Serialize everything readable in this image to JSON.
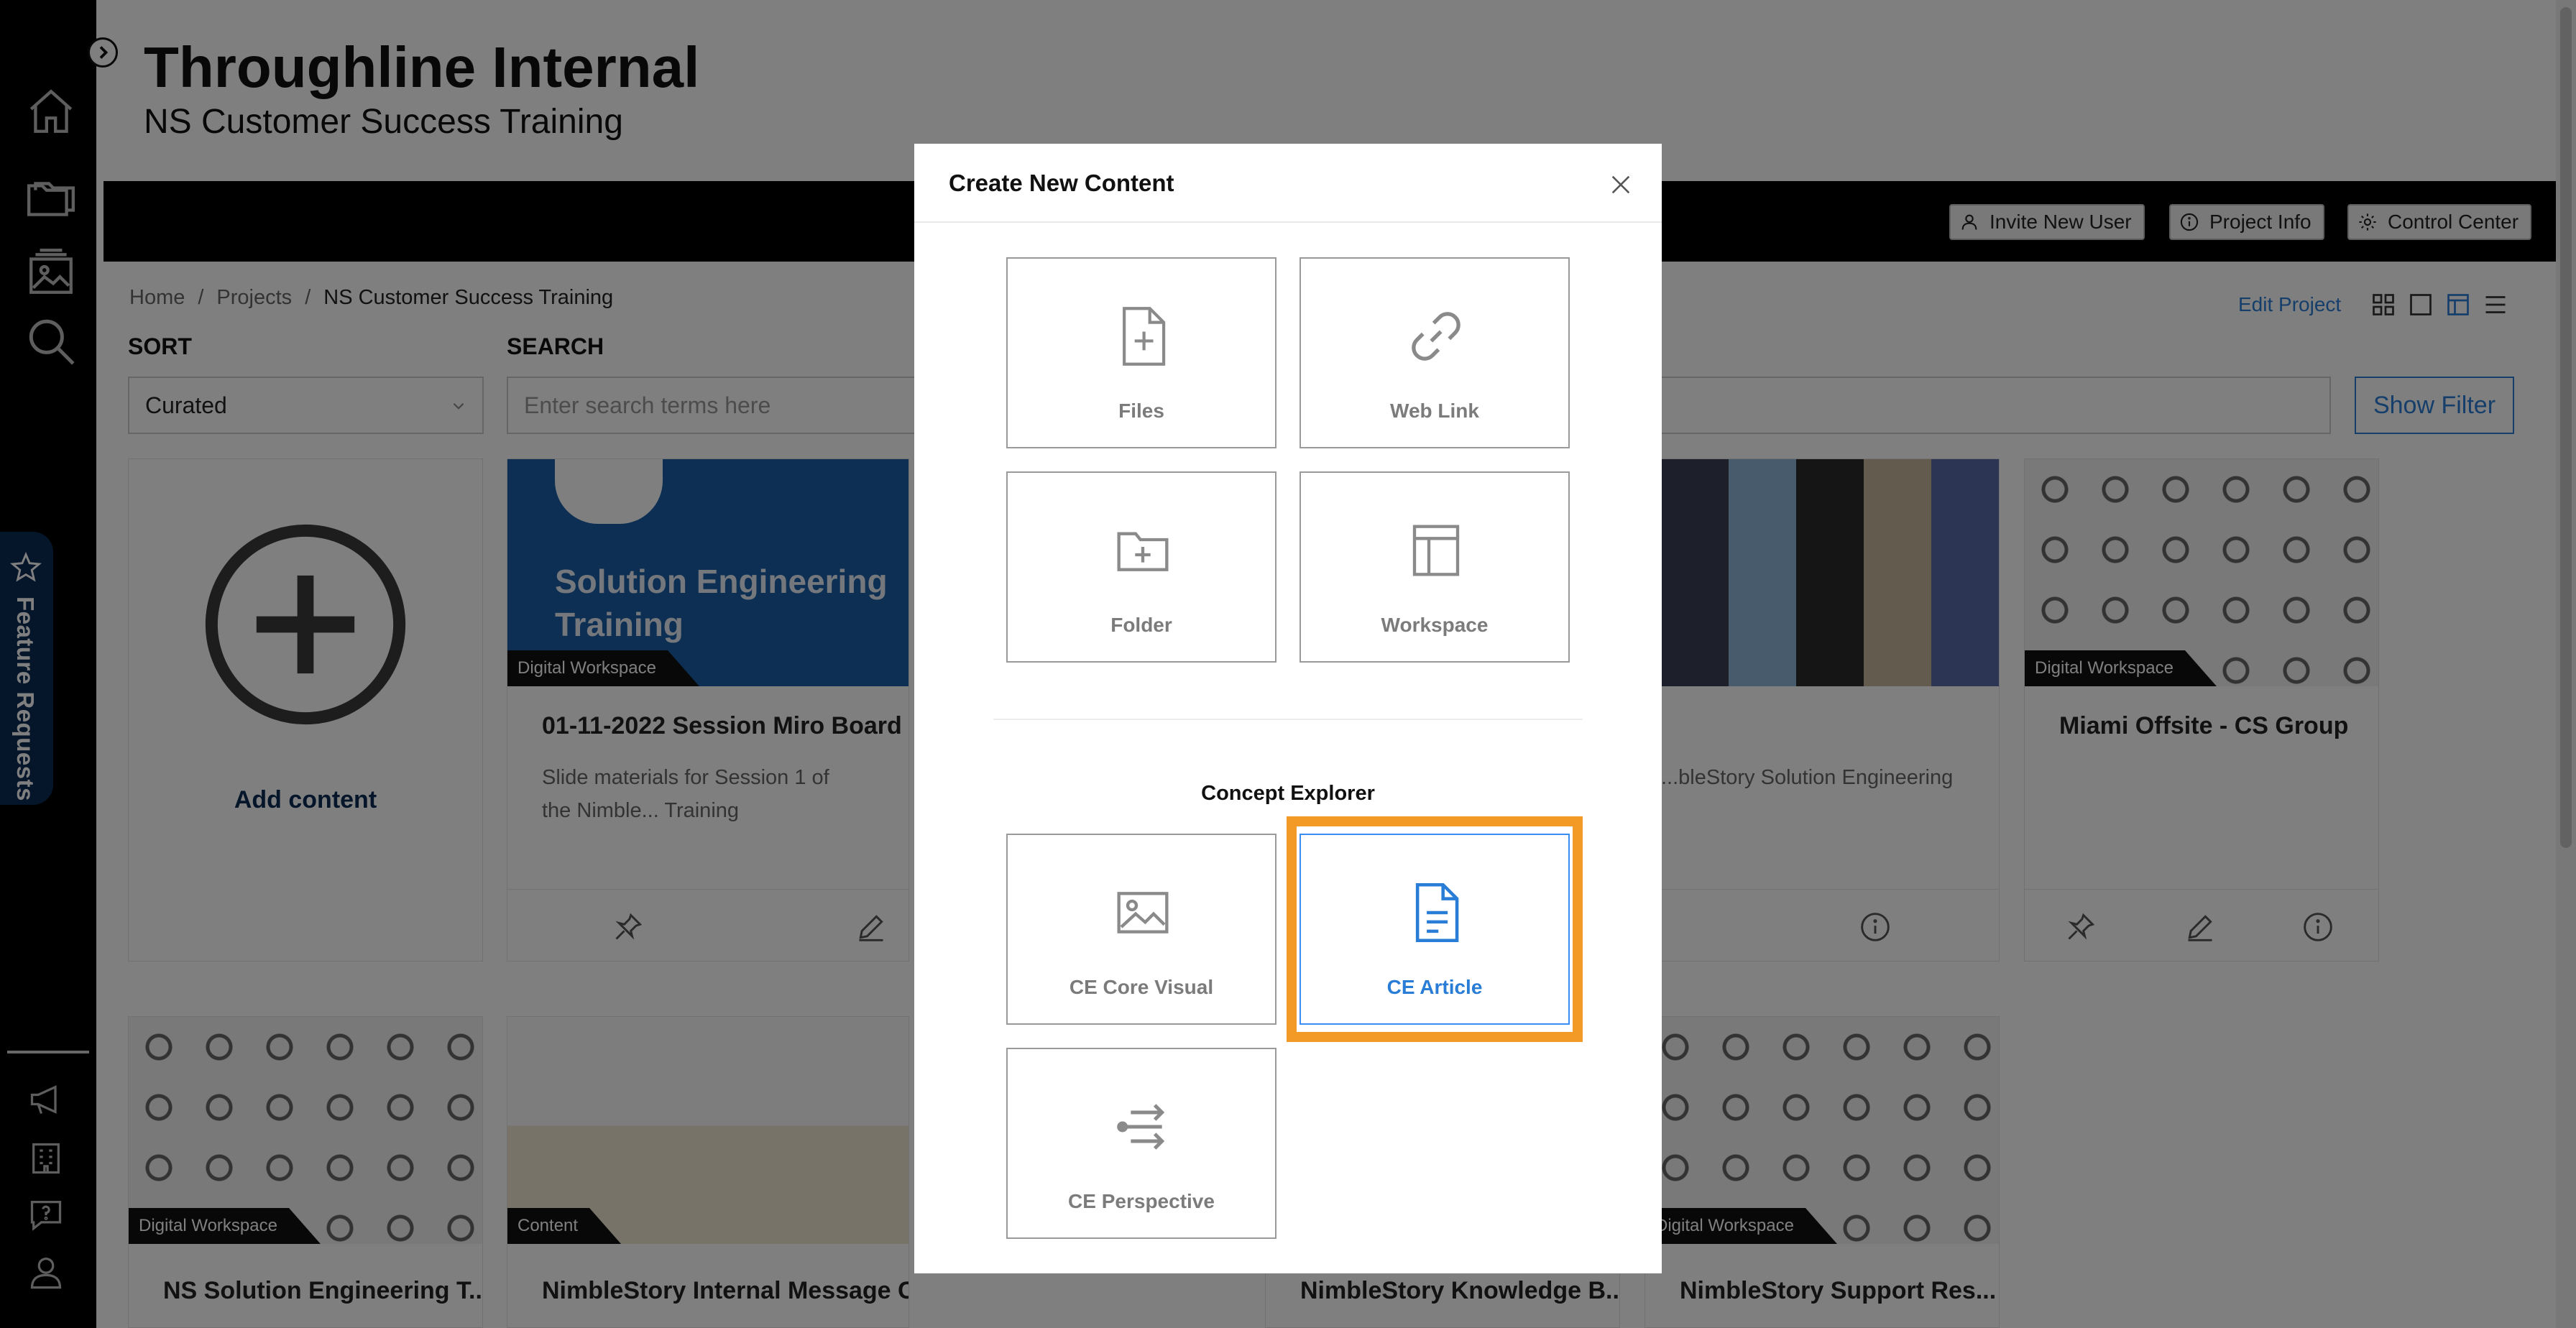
{
  "app": {
    "title": "Throughline Internal",
    "subtitle": "NS Customer Success Training"
  },
  "nav": {
    "feature_requests": "Feature Requests",
    "icons": [
      "home-icon",
      "folder-icon",
      "gallery-icon",
      "search-icon",
      "megaphone-icon",
      "building-icon",
      "help-chat-icon",
      "user-icon"
    ]
  },
  "header": {
    "invite": "Invite New User",
    "project_info": "Project Info",
    "control_center": "Control Center"
  },
  "breadcrumb": {
    "home": "Home",
    "projects": "Projects",
    "current": "NS Customer Success Training",
    "separator": "/"
  },
  "toolbar": {
    "edit_project": "Edit Project"
  },
  "sort": {
    "label": "SORT",
    "value": "Curated"
  },
  "search": {
    "label": "SEARCH",
    "placeholder": "Enter search terms here"
  },
  "filter": {
    "label": "Show Filter"
  },
  "cards": {
    "add": {
      "label": "Add content"
    },
    "c1": {
      "badge": "Digital Workspace",
      "title": "01-11-2022 Session Miro Board",
      "desc": "Slide materials for Session 1 of the Nimble... Training",
      "thumb_l1": "Solution Engineering",
      "thumb_l2": "Training"
    },
    "c3": {
      "desc": "...bleStory Solution Engineering"
    },
    "c4": {
      "badge": "Digital Workspace",
      "title": "Miami Offsite - CS Group"
    },
    "r2a": {
      "badge": "Digital Workspace",
      "title": "NS Solution Engineering T..."
    },
    "r2b": {
      "badge": "Content",
      "title": "NimbleStory Internal Message Card"
    },
    "r2c": {
      "title": "NimbleStory Knowledge B..."
    },
    "r2d": {
      "badge": "Digital Workspace",
      "title": "NimbleStory Support Res..."
    }
  },
  "modal": {
    "title": "Create New Content",
    "options": {
      "files": "Files",
      "web_link": "Web Link",
      "folder": "Folder",
      "workspace": "Workspace"
    },
    "section": "Concept Explorer",
    "ce": {
      "core_visual": "CE Core Visual",
      "article": "CE Article",
      "perspective": "CE Perspective"
    },
    "selected": "CE Article"
  },
  "colors": {
    "accent_blue": "#2a7dd6",
    "highlight_orange": "#f39a26",
    "nav_black": "#000000",
    "feature_tab_navy": "#0b2a55"
  }
}
